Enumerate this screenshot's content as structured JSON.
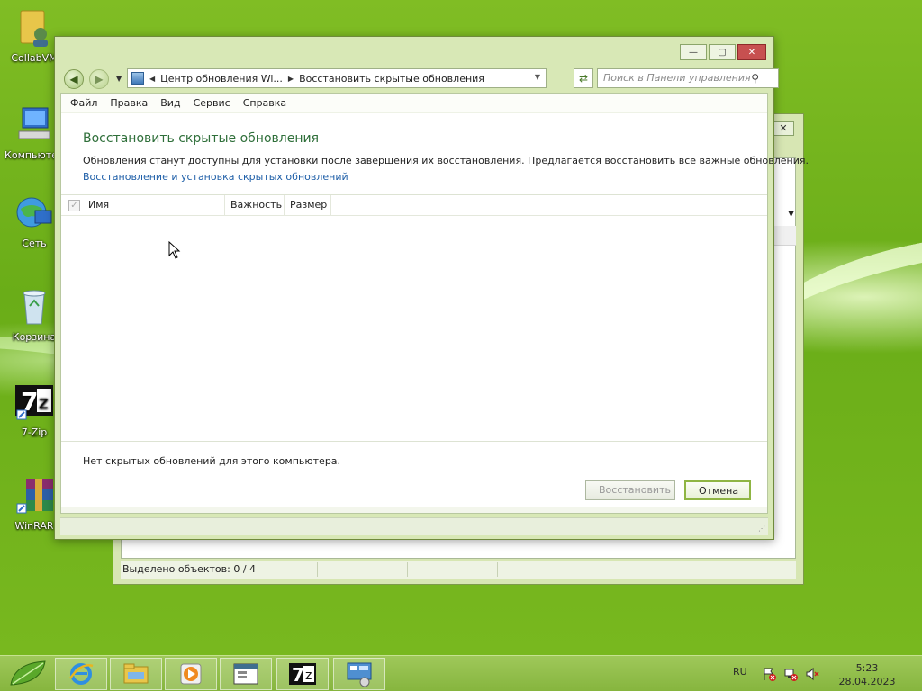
{
  "desktop": {
    "icons": [
      {
        "label": "CollabVM"
      },
      {
        "label": "Компьютер"
      },
      {
        "label": "Сеть"
      },
      {
        "label": "Корзина"
      },
      {
        "label": "7-Zip"
      },
      {
        "label": "WinRAR"
      }
    ]
  },
  "back_window": {
    "close_glyph": "✕",
    "status": "Выделено объектов: 0 / 4"
  },
  "window": {
    "caption": {
      "minimize": "—",
      "maximize": "▢",
      "close": "✕"
    },
    "address": {
      "segment1": "Центр обновления Wi...",
      "segment2": "Восстановить скрытые обновления"
    },
    "search": {
      "placeholder": "Поиск в Панели управления"
    },
    "menu": [
      "Файл",
      "Правка",
      "Вид",
      "Сервис",
      "Справка"
    ],
    "title": "Восстановить скрытые обновления",
    "description": "Обновления станут доступны для установки после завершения их восстановления. Предлагается восстановить все важные обновления.",
    "link": "Восстановление и установка скрытых обновлений",
    "columns": [
      "Имя",
      "Важность",
      "Размер"
    ],
    "empty_message": "Нет скрытых обновлений для этого компьютера.",
    "buttons": {
      "restore": "Восстановить",
      "cancel": "Отмена"
    }
  },
  "taskbar": {
    "language": "RU",
    "time": "5:23",
    "date": "28.04.2023"
  },
  "colors": {
    "accent_green": "#2f6f3a",
    "link_blue": "#1f5fa8",
    "window_frame": "#d8e8b6",
    "taskbar": "#9fc85a"
  }
}
